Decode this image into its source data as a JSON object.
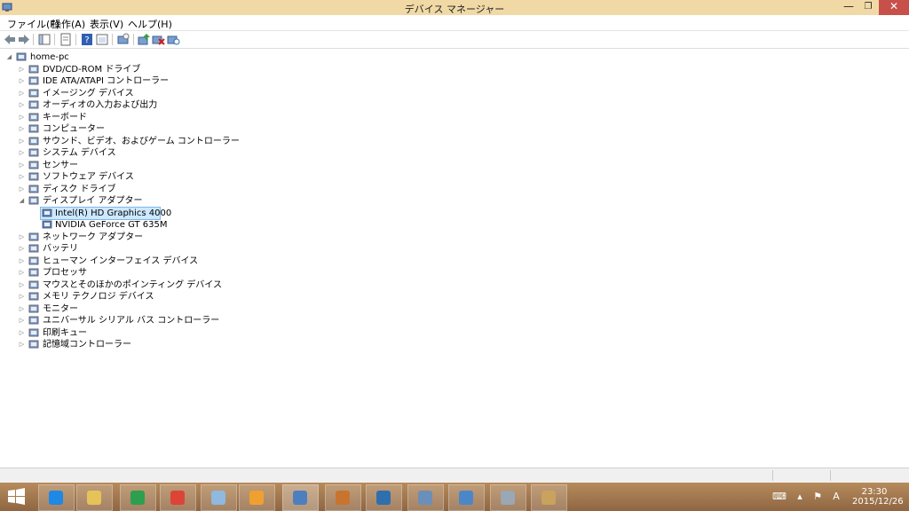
{
  "window": {
    "title": "デバイス マネージャー",
    "min_glyph": "—",
    "max_glyph": "❐",
    "close_glyph": "✕"
  },
  "menu": [
    "ファイル(F)",
    "操作(A)",
    "表示(V)",
    "ヘルプ(H)"
  ],
  "toolbar_icons": [
    "back-icon",
    "forward-icon",
    "console-tree-icon",
    "properties-icon",
    "help-icon",
    "view-icon",
    "scan-hardware-icon",
    "update-driver-icon",
    "disable-device-icon",
    "uninstall-device-icon"
  ],
  "tree": {
    "root": "home-pc",
    "categories": [
      {
        "label": "DVD/CD-ROM ドライブ",
        "icon": "dvd-drive-icon"
      },
      {
        "label": "IDE ATA/ATAPI コントローラー",
        "icon": "ide-controller-icon"
      },
      {
        "label": "イメージング デバイス",
        "icon": "camera-icon"
      },
      {
        "label": "オーディオの入力および出力",
        "icon": "speaker-icon"
      },
      {
        "label": "キーボード",
        "icon": "keyboard-icon"
      },
      {
        "label": "コンピューター",
        "icon": "computer-icon"
      },
      {
        "label": "サウンド、ビデオ、およびゲーム コントローラー",
        "icon": "sound-icon"
      },
      {
        "label": "システム デバイス",
        "icon": "system-device-icon"
      },
      {
        "label": "センサー",
        "icon": "sensor-icon"
      },
      {
        "label": "ソフトウェア デバイス",
        "icon": "software-device-icon"
      },
      {
        "label": "ディスク ドライブ",
        "icon": "disk-drive-icon"
      },
      {
        "label": "ディスプレイ アダプター",
        "icon": "display-adapter-icon",
        "expanded": true,
        "children": [
          {
            "label": "Intel(R) HD Graphics 4000",
            "selected": true
          },
          {
            "label": "NVIDIA GeForce GT 635M"
          }
        ]
      },
      {
        "label": "ネットワーク アダプター",
        "icon": "network-adapter-icon"
      },
      {
        "label": "バッテリ",
        "icon": "battery-icon"
      },
      {
        "label": "ヒューマン インターフェイス デバイス",
        "icon": "hid-icon"
      },
      {
        "label": "プロセッサ",
        "icon": "processor-icon"
      },
      {
        "label": "マウスとそのほかのポインティング デバイス",
        "icon": "mouse-icon"
      },
      {
        "label": "メモリ テクノロジ デバイス",
        "icon": "memory-icon"
      },
      {
        "label": "モニター",
        "icon": "monitor-icon"
      },
      {
        "label": "ユニバーサル シリアル バス コントローラー",
        "icon": "usb-icon"
      },
      {
        "label": "印刷キュー",
        "icon": "printer-icon"
      },
      {
        "label": "記憶域コントローラー",
        "icon": "storage-controller-icon"
      }
    ]
  },
  "taskbar": {
    "apps": [
      {
        "name": "internet-explorer-icon",
        "color": "#1e88e5"
      },
      {
        "name": "file-explorer-icon",
        "color": "#e6c35a"
      },
      {
        "name": "store-icon",
        "color": "#2e9e4f"
      },
      {
        "name": "chrome-icon",
        "color": "#db4437"
      },
      {
        "name": "mail-icon",
        "color": "#8fb9de"
      },
      {
        "name": "media-player-icon",
        "color": "#f0a030"
      },
      {
        "name": "device-manager-icon",
        "color": "#4d7fbf"
      },
      {
        "name": "app-icon",
        "color": "#c8742e"
      },
      {
        "name": "globe-app-icon",
        "color": "#2f6fae"
      },
      {
        "name": "network-app-icon",
        "color": "#6a8fb8"
      },
      {
        "name": "remote-desktop-icon",
        "color": "#4b87c8"
      },
      {
        "name": "device-tool-icon",
        "color": "#9aa7b5"
      },
      {
        "name": "paint-icon",
        "color": "#c9a25e"
      }
    ],
    "clock_time": "23:30",
    "clock_date": "2015/12/26",
    "ime_label": "A"
  }
}
